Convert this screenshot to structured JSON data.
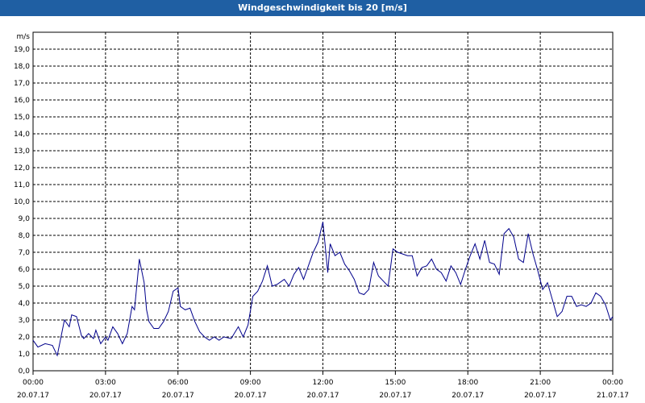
{
  "window": {
    "title": "Windgeschwindigkeit bis 20 [m/s]"
  },
  "chart_data": {
    "type": "line",
    "title": "Windgeschwindigkeit bis 20 [m/s]",
    "ylabel": "m/s",
    "xlabel": "",
    "ylim": [
      0,
      20
    ],
    "xlim_hours": [
      0,
      24
    ],
    "grid": true,
    "line_color": "#00008b",
    "y_ticks": [
      "0,0",
      "1,0",
      "2,0",
      "3,0",
      "4,0",
      "5,0",
      "6,0",
      "7,0",
      "8,0",
      "9,0",
      "10,0",
      "11,0",
      "12,0",
      "13,0",
      "14,0",
      "15,0",
      "16,0",
      "17,0",
      "18,0",
      "19,0"
    ],
    "x_ticks": [
      {
        "time": "00:00",
        "date": "20.07.17"
      },
      {
        "time": "03:00",
        "date": "20.07.17"
      },
      {
        "time": "06:00",
        "date": "20.07.17"
      },
      {
        "time": "09:00",
        "date": "20.07.17"
      },
      {
        "time": "12:00",
        "date": "20.07.17"
      },
      {
        "time": "15:00",
        "date": "20.07.17"
      },
      {
        "time": "18:00",
        "date": "20.07.17"
      },
      {
        "time": "21:00",
        "date": "20.07.17"
      },
      {
        "time": "00:00",
        "date": "21.07.17"
      }
    ],
    "series": [
      {
        "hours": [
          0,
          0.2,
          0.5,
          0.8,
          1.0,
          1.1,
          1.3,
          1.5,
          1.6,
          1.8,
          2.0,
          2.1,
          2.3,
          2.5,
          2.6,
          2.8,
          3.0,
          3.1,
          3.3,
          3.5,
          3.7,
          3.9,
          4.1,
          4.2,
          4.4,
          4.6,
          4.7,
          4.8,
          5.0,
          5.2,
          5.4,
          5.6,
          5.8,
          6.0,
          6.1,
          6.3,
          6.5,
          6.7,
          6.9,
          7.1,
          7.3,
          7.5,
          7.7,
          7.9,
          8.2,
          8.5,
          8.7,
          8.9,
          9.1,
          9.3,
          9.5,
          9.7,
          9.9,
          10.1,
          10.4,
          10.6,
          10.8,
          11.0,
          11.2,
          11.4,
          11.6,
          11.8,
          12.0,
          12.2,
          12.3,
          12.5,
          12.7,
          12.9,
          13.1,
          13.3,
          13.5,
          13.7,
          13.9,
          14.1,
          14.3,
          14.5,
          14.7,
          14.9,
          15.1,
          15.3,
          15.5,
          15.7,
          15.9,
          16.1,
          16.3,
          16.5,
          16.7,
          16.9,
          17.1,
          17.3,
          17.5,
          17.7,
          17.9,
          18.1,
          18.3,
          18.5,
          18.7,
          18.9,
          19.1,
          19.3,
          19.5,
          19.7,
          19.9,
          20.1,
          20.3,
          20.5,
          20.7,
          20.9,
          21.1,
          21.3,
          21.5,
          21.7,
          21.9,
          22.1,
          22.3,
          22.5,
          22.7,
          22.9,
          23.1,
          23.3,
          23.5,
          23.7,
          23.9,
          24.0
        ],
        "values": [
          1.8,
          1.4,
          1.6,
          1.5,
          0.9,
          1.6,
          3.0,
          2.6,
          3.3,
          3.2,
          2.1,
          1.9,
          2.2,
          1.9,
          2.4,
          1.6,
          2.0,
          1.8,
          2.6,
          2.2,
          1.6,
          2.2,
          3.8,
          3.6,
          6.6,
          5.2,
          3.6,
          2.9,
          2.5,
          2.5,
          2.9,
          3.5,
          4.7,
          4.9,
          3.8,
          3.6,
          3.7,
          2.9,
          2.3,
          2.0,
          1.8,
          2.0,
          1.8,
          2.0,
          1.9,
          2.6,
          2.0,
          2.7,
          4.4,
          4.7,
          5.3,
          6.2,
          5.0,
          5.1,
          5.4,
          5.0,
          5.7,
          6.1,
          5.4,
          6.2,
          7.0,
          7.6,
          8.8,
          5.8,
          7.5,
          6.8,
          7.0,
          6.3,
          5.9,
          5.4,
          4.6,
          4.5,
          4.8,
          6.4,
          5.6,
          5.3,
          5.0,
          7.2,
          7.0,
          6.9,
          6.8,
          6.8,
          5.6,
          6.1,
          6.2,
          6.6,
          6.0,
          5.8,
          5.3,
          6.2,
          5.8,
          5.1,
          6.0,
          6.8,
          7.5,
          6.6,
          7.7,
          6.4,
          6.3,
          5.7,
          8.1,
          8.4,
          7.9,
          6.6,
          6.4,
          8.1,
          6.9,
          5.9,
          4.8,
          5.2,
          4.2,
          3.2,
          3.5,
          4.4,
          4.4,
          3.8,
          3.9,
          3.8,
          4.0,
          4.6,
          4.4,
          3.9,
          3.0,
          3.2,
          3.9,
          3.7
        ]
      }
    ]
  }
}
